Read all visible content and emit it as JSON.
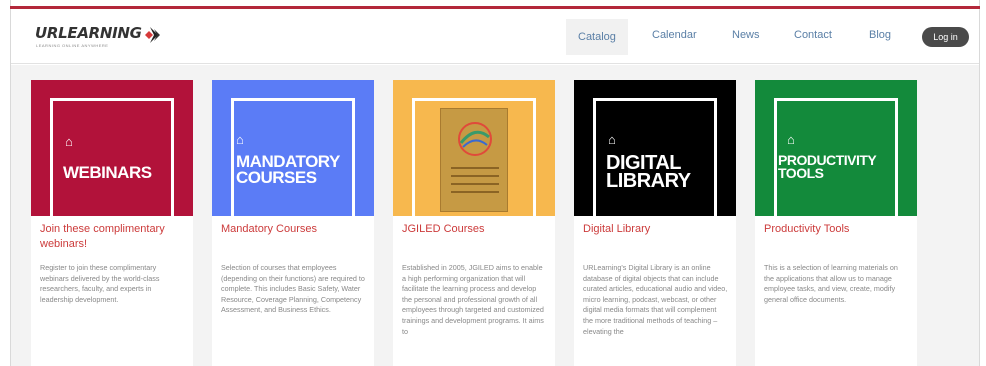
{
  "logo": {
    "text": "URLEARNING",
    "subtitle": "LEARNING ONLINE ANYWHERE"
  },
  "nav": {
    "items": [
      {
        "label": "Catalog",
        "active": true
      },
      {
        "label": "Calendar"
      },
      {
        "label": "News"
      },
      {
        "label": "Contact"
      },
      {
        "label": "Blog"
      }
    ],
    "login_label": "Log in"
  },
  "colors": {
    "brand_red": "#b3283a",
    "link_blue": "#5a7fa6",
    "card_title_red": "#cc3b3b",
    "webinars_bg": "#b2123a",
    "mandatory_bg": "#5b7cf6",
    "jgiled_bg": "#f7b84e",
    "library_bg": "#000000",
    "productivity_bg": "#138a3b"
  },
  "cards": [
    {
      "image_label": "WEBINARS",
      "title": "Join these complimentary webinars!",
      "text": "Register to join these complimentary webinars delivered by the world-class researchers, faculty, and experts in leadership development."
    },
    {
      "image_label_line1": "MANDATORY",
      "image_label_line2": "COURSES",
      "title": "Mandatory Courses",
      "text": "Selection of courses that employees (depending on their functions) are required to complete. This includes Basic Safety, Water Resource, Coverage Planning, Competency Assessment, and Business Ethics."
    },
    {
      "title": "JGILED Courses",
      "text": "Established in 2005, JGILED aims to enable a high performing organization that will facilitate the learning process and develop the personal and professional growth of all employees through targeted and customized trainings and development programs. It aims to"
    },
    {
      "image_label_line1": "DIGITAL",
      "image_label_line2": "LIBRARY",
      "title": "Digital Library",
      "text": "URLearning's Digital Library is an online database of digital objects that can include curated articles, educational audio and video, micro learning, podcast, webcast, or other digital media formats that will complement the more traditional methods of teaching – elevating the"
    },
    {
      "image_label_line1": "PRODUCTIVITY",
      "image_label_line2": "TOOLS",
      "title": "Productivity Tools",
      "text": "This is a selection of learning materials on the applications that allow us to manage employee tasks, and view, create, modify general office documents."
    }
  ]
}
